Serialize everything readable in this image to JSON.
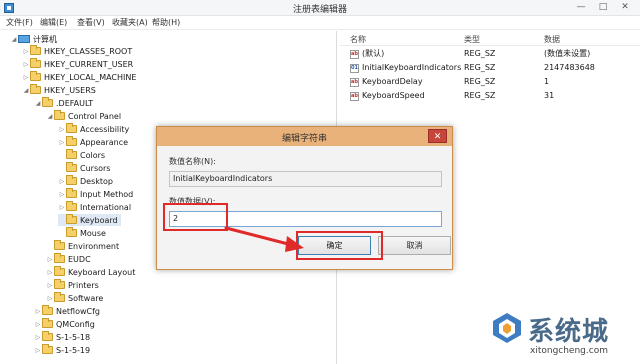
{
  "window": {
    "title": "注册表编辑器",
    "minimize": "—",
    "maximize": "□",
    "close": "✕"
  },
  "menu": [
    "文件(F)",
    "编辑(E)",
    "查看(V)",
    "收藏夹(A)",
    "帮助(H)"
  ],
  "tree": {
    "root": "计算机",
    "hives": [
      "HKEY_CLASSES_ROOT",
      "HKEY_CURRENT_USER",
      "HKEY_LOCAL_MACHINE",
      "HKEY_USERS"
    ],
    "default": ".DEFAULT",
    "control_panel": "Control Panel",
    "cp_children": [
      "Accessibility",
      "Appearance",
      "Colors",
      "Cursors",
      "Desktop",
      "Input Method",
      "International",
      "Keyboard",
      "Mouse"
    ],
    "default_children": [
      "Environment",
      "EUDC",
      "Keyboard Layout",
      "Printers",
      "Software"
    ],
    "users_children": [
      "NetflowCfg",
      "QMConfig",
      "S-1-5-18",
      "S-1-5-19"
    ]
  },
  "list": {
    "headers": {
      "name": "名称",
      "type": "类型",
      "data": "数据"
    },
    "rows": [
      {
        "icon": "ab",
        "name": "(默认)",
        "type": "REG_SZ",
        "data": "(数值未设置)"
      },
      {
        "icon": "01",
        "name": "InitialKeyboardIndicators",
        "type": "REG_SZ",
        "data": "2147483648"
      },
      {
        "icon": "ab",
        "name": "KeyboardDelay",
        "type": "REG_SZ",
        "data": "1"
      },
      {
        "icon": "ab",
        "name": "KeyboardSpeed",
        "type": "REG_SZ",
        "data": "31"
      }
    ]
  },
  "dialog": {
    "title": "编辑字符串",
    "close": "✕",
    "name_label": "数值名称(N):",
    "name_value": "InitialKeyboardIndicators",
    "data_label": "数值数据(V):",
    "data_value": "2",
    "ok": "确定",
    "cancel": "取消"
  },
  "watermark": {
    "main": "系统城",
    "sub": "xitongcheng.com"
  },
  "colors": {
    "annotation": "#e02a2a",
    "dialog_title": "#e9b27a",
    "close_button": "#c7463b",
    "folder": "#f5cf68"
  }
}
